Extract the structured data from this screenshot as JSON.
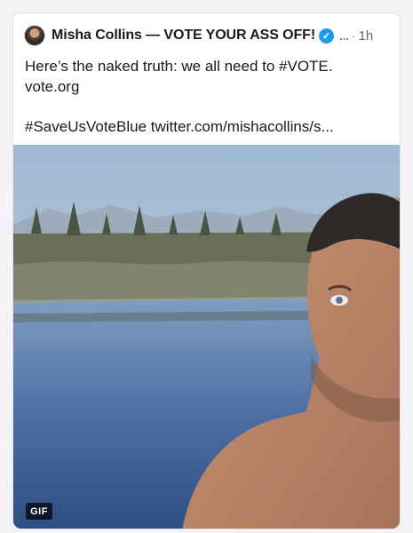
{
  "post": {
    "author_name": "Misha Collins — VOTE YOUR ASS OFF!",
    "verified_icon": "verified-check-icon",
    "more_label": "...",
    "separator": "·",
    "timestamp": "1h",
    "text_line_1": "Here’s the naked truth: we all need to #VOTE.",
    "text_line_2": "vote.org",
    "text_line_3": "#SaveUsVoteBlue twitter.com/mishacollins/s...",
    "media_badge": "GIF"
  },
  "colors": {
    "verified_blue": "#1d9bf0",
    "text": "#1a1a1a",
    "muted": "#666666"
  }
}
